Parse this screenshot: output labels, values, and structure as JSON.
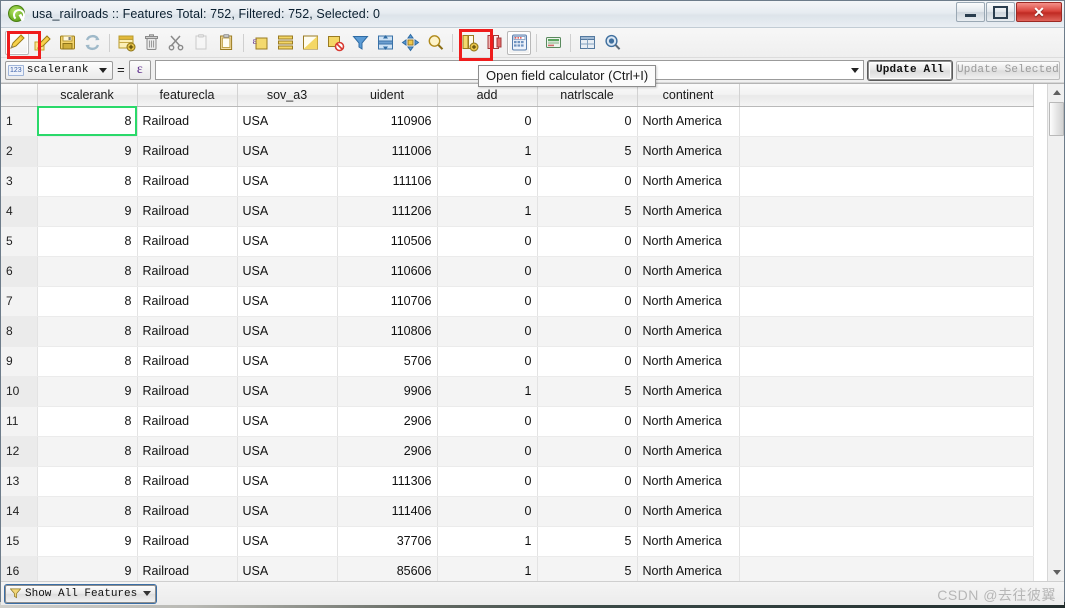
{
  "window": {
    "title": "usa_railroads :: Features Total: 752, Filtered: 752, Selected: 0",
    "app_icon": "qgis-logo-icon",
    "controls": {
      "minimize": "minimize-icon",
      "maximize": "maximize-icon",
      "close": "✕"
    }
  },
  "toolbar": {
    "buttons": [
      {
        "name": "toggle-editing",
        "tip": "Toggle editing mode",
        "highlighted": true
      },
      {
        "name": "save-edits",
        "tip": "Save edits"
      },
      {
        "name": "save-layer-edits",
        "tip": "Save layer edits"
      },
      {
        "name": "reload-table",
        "tip": "Reload the table"
      },
      {
        "name": "add-feature",
        "tip": "Add feature"
      },
      {
        "name": "delete-selected",
        "tip": "Delete selected features"
      },
      {
        "name": "cut-features",
        "tip": "Cut selected features"
      },
      {
        "name": "copy-features",
        "tip": "Copy selected features"
      },
      {
        "name": "paste-features",
        "tip": "Paste features"
      },
      {
        "name": "select-by-expression",
        "tip": "Select features using an expression"
      },
      {
        "name": "select-all",
        "tip": "Select all features"
      },
      {
        "name": "invert-selection",
        "tip": "Invert selection"
      },
      {
        "name": "deselect-all",
        "tip": "Deselect all features"
      },
      {
        "name": "filter-select",
        "tip": "Filter / select features using form"
      },
      {
        "name": "move-selection-to-top",
        "tip": "Move selection to top"
      },
      {
        "name": "pan-map-to-selected",
        "tip": "Pan map to the selected rows"
      },
      {
        "name": "zoom-map-to-selected",
        "tip": "Zoom map to the selected rows"
      },
      {
        "name": "new-field",
        "tip": "New field"
      },
      {
        "name": "delete-field",
        "tip": "Delete field"
      },
      {
        "name": "open-field-calculator",
        "tip": "Open field calculator (Ctrl+I)",
        "highlighted": true
      },
      {
        "name": "conditional-formatting",
        "tip": "Conditional formatting"
      },
      {
        "name": "organize-columns",
        "tip": "Organize columns"
      },
      {
        "name": "actions",
        "tip": "Actions"
      }
    ]
  },
  "tooltip": {
    "text": "Open field calculator (Ctrl+I)",
    "for": "open-field-calculator"
  },
  "expression_bar": {
    "field_type_badge": "123",
    "field_name": "scalerank",
    "equals": "=",
    "expression_builder_glyph": "ε",
    "expression_value": "",
    "expression_placeholder": "",
    "update_all_label": "Update All",
    "update_selected_label": "Update Selected",
    "update_selected_enabled": false
  },
  "table": {
    "columns": [
      "scalerank",
      "featurecla",
      "sov_a3",
      "uident",
      "add",
      "natrlscale",
      "continent"
    ],
    "column_align": [
      "num",
      "txt",
      "txt",
      "num",
      "num",
      "num",
      "txt"
    ],
    "selected_cell": {
      "row": 0,
      "column": "scalerank",
      "color": "#2ad96a"
    },
    "rows": [
      {
        "n": "1",
        "scalerank": "8",
        "featurecla": "Railroad",
        "sov_a3": "USA",
        "uident": "110906",
        "add": "0",
        "natrlscale": "0",
        "continent": "North America"
      },
      {
        "n": "2",
        "scalerank": "9",
        "featurecla": "Railroad",
        "sov_a3": "USA",
        "uident": "111006",
        "add": "1",
        "natrlscale": "5",
        "continent": "North America"
      },
      {
        "n": "3",
        "scalerank": "8",
        "featurecla": "Railroad",
        "sov_a3": "USA",
        "uident": "111106",
        "add": "0",
        "natrlscale": "0",
        "continent": "North America"
      },
      {
        "n": "4",
        "scalerank": "9",
        "featurecla": "Railroad",
        "sov_a3": "USA",
        "uident": "111206",
        "add": "1",
        "natrlscale": "5",
        "continent": "North America"
      },
      {
        "n": "5",
        "scalerank": "8",
        "featurecla": "Railroad",
        "sov_a3": "USA",
        "uident": "110506",
        "add": "0",
        "natrlscale": "0",
        "continent": "North America"
      },
      {
        "n": "6",
        "scalerank": "8",
        "featurecla": "Railroad",
        "sov_a3": "USA",
        "uident": "110606",
        "add": "0",
        "natrlscale": "0",
        "continent": "North America"
      },
      {
        "n": "7",
        "scalerank": "8",
        "featurecla": "Railroad",
        "sov_a3": "USA",
        "uident": "110706",
        "add": "0",
        "natrlscale": "0",
        "continent": "North America"
      },
      {
        "n": "8",
        "scalerank": "8",
        "featurecla": "Railroad",
        "sov_a3": "USA",
        "uident": "110806",
        "add": "0",
        "natrlscale": "0",
        "continent": "North America"
      },
      {
        "n": "9",
        "scalerank": "8",
        "featurecla": "Railroad",
        "sov_a3": "USA",
        "uident": "5706",
        "add": "0",
        "natrlscale": "0",
        "continent": "North America"
      },
      {
        "n": "10",
        "scalerank": "9",
        "featurecla": "Railroad",
        "sov_a3": "USA",
        "uident": "9906",
        "add": "1",
        "natrlscale": "5",
        "continent": "North America"
      },
      {
        "n": "11",
        "scalerank": "8",
        "featurecla": "Railroad",
        "sov_a3": "USA",
        "uident": "2906",
        "add": "0",
        "natrlscale": "0",
        "continent": "North America"
      },
      {
        "n": "12",
        "scalerank": "8",
        "featurecla": "Railroad",
        "sov_a3": "USA",
        "uident": "2906",
        "add": "0",
        "natrlscale": "0",
        "continent": "North America"
      },
      {
        "n": "13",
        "scalerank": "8",
        "featurecla": "Railroad",
        "sov_a3": "USA",
        "uident": "111306",
        "add": "0",
        "natrlscale": "0",
        "continent": "North America"
      },
      {
        "n": "14",
        "scalerank": "8",
        "featurecla": "Railroad",
        "sov_a3": "USA",
        "uident": "111406",
        "add": "0",
        "natrlscale": "0",
        "continent": "North America"
      },
      {
        "n": "15",
        "scalerank": "9",
        "featurecla": "Railroad",
        "sov_a3": "USA",
        "uident": "37706",
        "add": "1",
        "natrlscale": "5",
        "continent": "North America"
      },
      {
        "n": "16",
        "scalerank": "9",
        "featurecla": "Railroad",
        "sov_a3": "USA",
        "uident": "85606",
        "add": "1",
        "natrlscale": "5",
        "continent": "North America"
      }
    ]
  },
  "statusbar": {
    "show_all_features_label": "Show All Features",
    "filter_icon": "filter-icon",
    "watermark": "CSDN @去往彼翼"
  }
}
